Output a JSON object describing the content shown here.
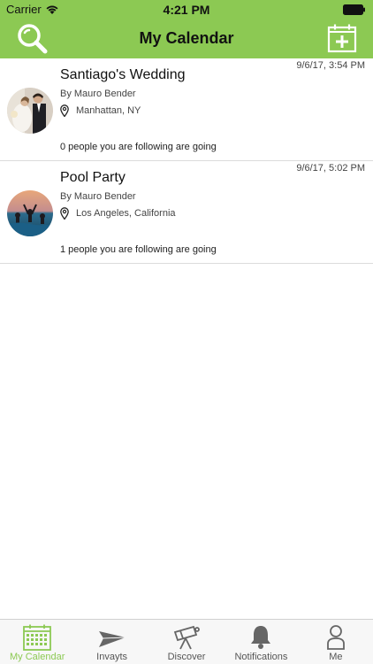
{
  "status_bar": {
    "carrier": "Carrier",
    "time": "4:21 PM"
  },
  "nav": {
    "title": "My Calendar",
    "search_icon": "search-icon",
    "add_icon": "add-event-icon"
  },
  "colors": {
    "accent": "#8cc953",
    "tab_inactive": "#555555"
  },
  "events": [
    {
      "title": "Santiago's Wedding",
      "date": "9/6/17, 3:54 PM",
      "by": "By Mauro Bender",
      "location": "Manhattan, NY",
      "going": "0 people you are following are going"
    },
    {
      "title": "Pool Party",
      "date": "9/6/17, 5:02 PM",
      "by": "By Mauro Bender",
      "location": "Los Angeles, California",
      "going": "1 people you are following are going"
    }
  ],
  "tabs": [
    {
      "label": "My Calendar",
      "icon": "calendar-icon",
      "active": true
    },
    {
      "label": "Invayts",
      "icon": "paper-plane-icon",
      "active": false
    },
    {
      "label": "Discover",
      "icon": "telescope-icon",
      "active": false
    },
    {
      "label": "Notifications",
      "icon": "bell-icon",
      "active": false
    },
    {
      "label": "Me",
      "icon": "person-icon",
      "active": false
    }
  ]
}
